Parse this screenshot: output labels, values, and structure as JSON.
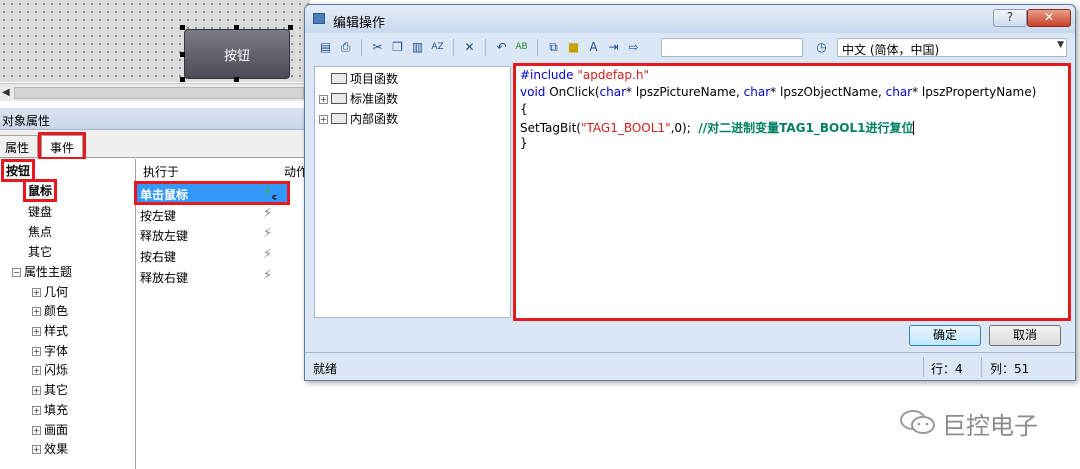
{
  "canvas": {
    "button_label": "按钮"
  },
  "object_properties": {
    "title": "对象属性",
    "tabs": [
      "属性",
      "事件"
    ],
    "tree": {
      "root": "按钮",
      "items": [
        "鼠标",
        "键盘",
        "焦点",
        "其它"
      ],
      "group": "属性主题",
      "sub_items": [
        "几何",
        "颜色",
        "样式",
        "字体",
        "闪烁",
        "其它",
        "填充",
        "画面",
        "效果"
      ]
    },
    "grid": {
      "headers": [
        "执行于",
        "动作"
      ],
      "rows": [
        "单击鼠标",
        "按左键",
        "释放左键",
        "按右键",
        "释放右键"
      ],
      "selected_action_badge": "c"
    }
  },
  "dialog": {
    "title": "编辑操作",
    "help_label": "?",
    "close_label": "✕",
    "language": "中文 (简体，中国)",
    "function_tree": [
      "项目函数",
      "标准函数",
      "内部函数"
    ],
    "code": {
      "line1_a": "#include ",
      "line1_b": "\"apdefap.h\"",
      "line2_kw1": "void",
      "line2_a": " OnClick(",
      "line2_kw2": "char",
      "line2_b": "* lpszPictureName, ",
      "line2_kw3": "char",
      "line2_c": "* lpszObjectName, ",
      "line2_kw4": "char",
      "line2_d": "* lpszPropertyName)",
      "line3": "{",
      "line4_a": "SetTagBit(",
      "line4_str": "\"TAG1_BOOL1\"",
      "line4_b": ",0);  ",
      "line4_cm": "//对二进制变量TAG1_BOOL1进行复位",
      "line5": "}"
    },
    "ok_label": "确定",
    "cancel_label": "取消",
    "status": "就绪",
    "row": "行：4",
    "col": "列：51"
  },
  "watermark": {
    "text": "巨控电子"
  }
}
